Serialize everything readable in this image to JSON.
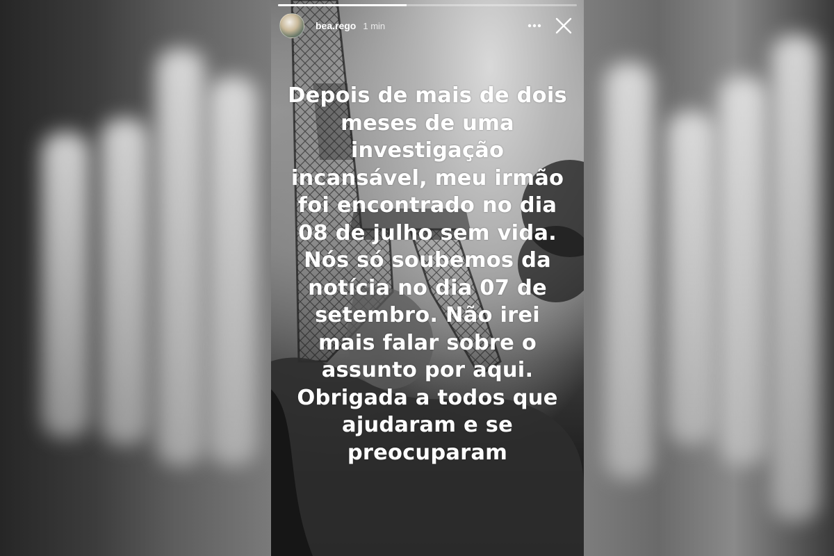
{
  "story": {
    "username": "bea.rego",
    "time": "1 min",
    "progress": 0.43,
    "caption_lines": [
      "Depois de mais de dois",
      "meses de uma",
      "investigação",
      "incansável, meu irmão",
      "foi encontrado no dia",
      "08 de julho sem vida.",
      "Nós só soubemos da",
      "notícia no dia 07 de",
      "setembro. Não irei",
      "mais falar sobre o",
      "assunto por aqui.",
      "Obrigada a todos que",
      "ajudaram e se",
      "preocuparam"
    ],
    "icons": {
      "more": "more-horizontal-icon",
      "close": "close-icon"
    }
  },
  "colors": {
    "text": "#ffffff",
    "progress_track": "rgba(255,255,255,0.35)",
    "progress_fill": "#ffffff"
  }
}
